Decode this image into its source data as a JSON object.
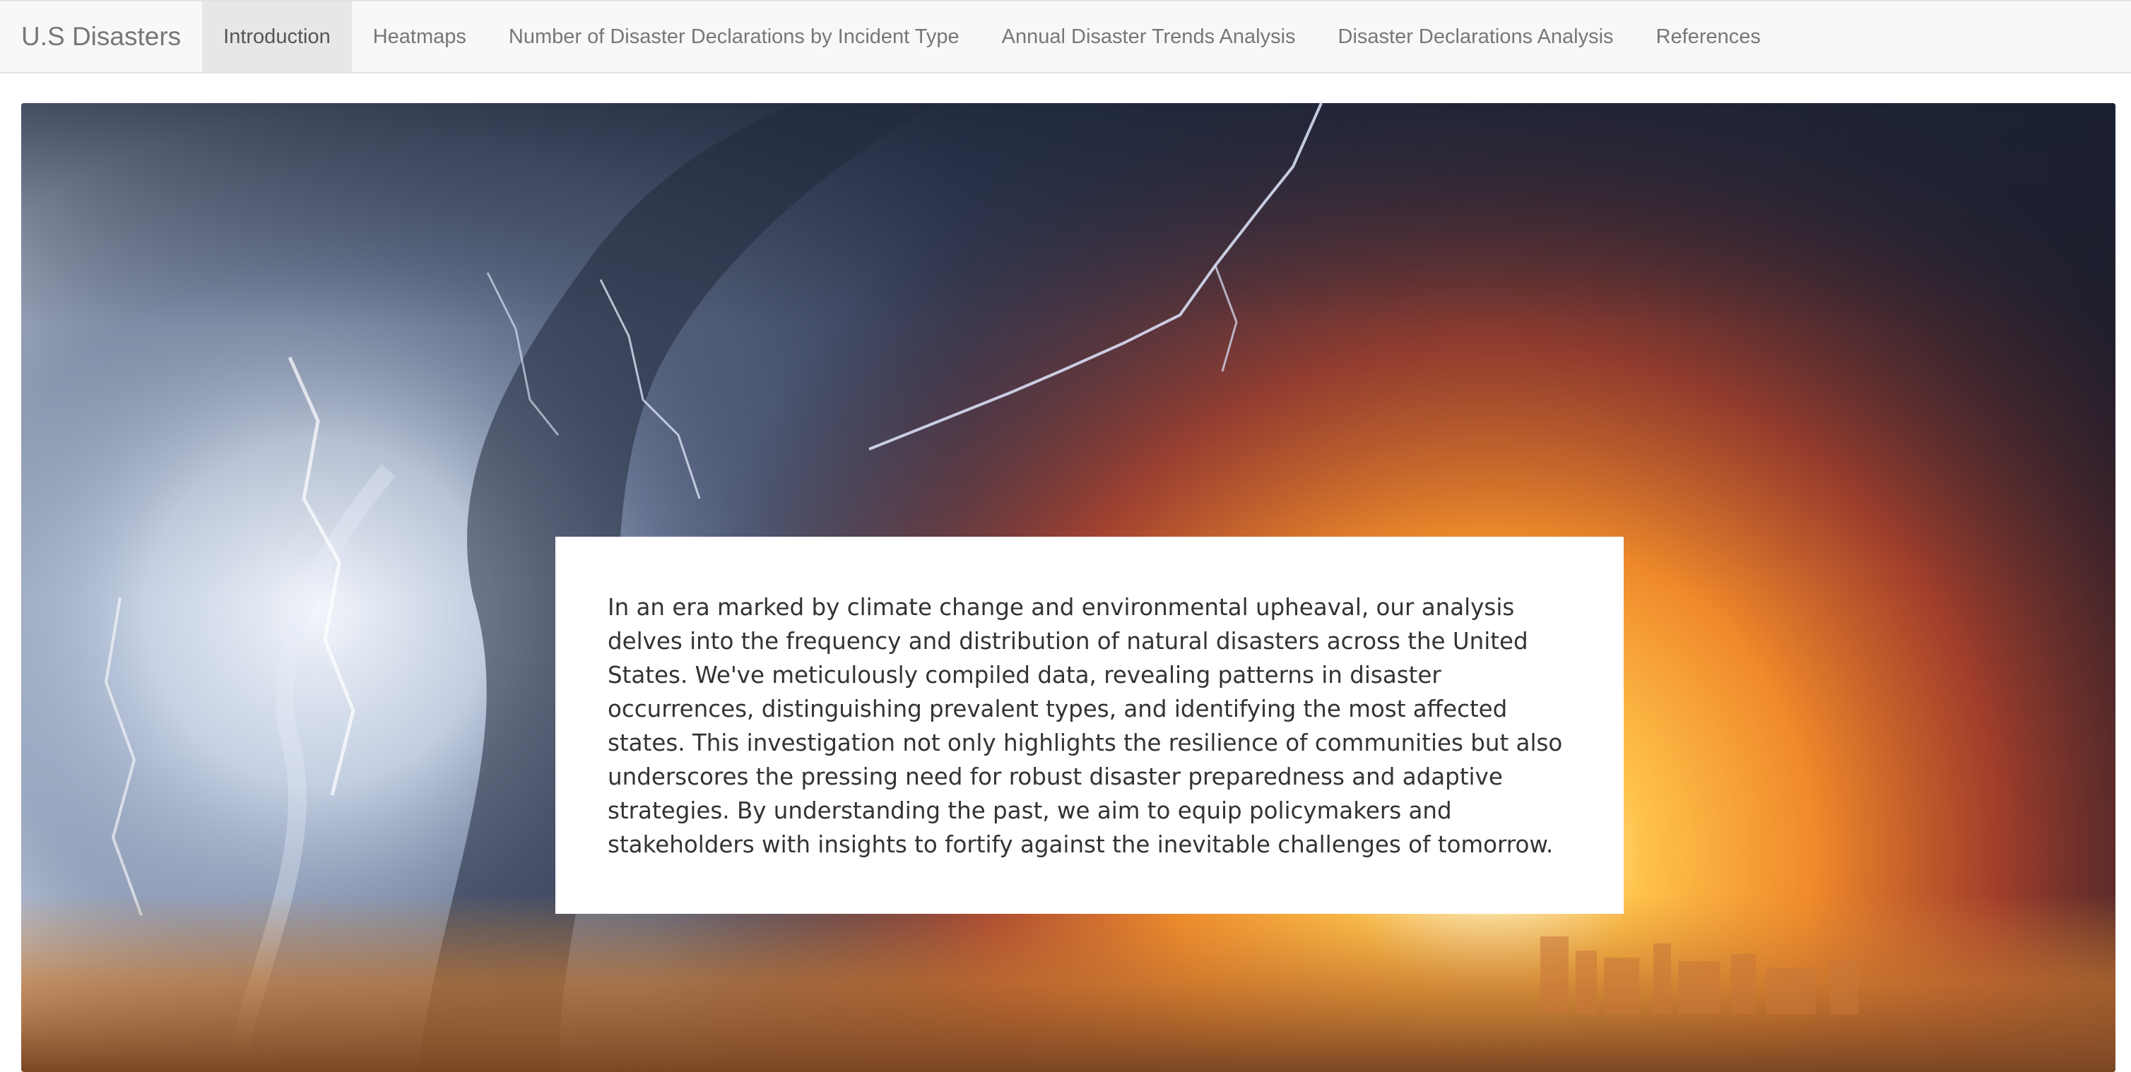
{
  "navbar": {
    "brand": "U.S Disasters",
    "items": [
      {
        "label": "Introduction",
        "active": true
      },
      {
        "label": "Heatmaps",
        "active": false
      },
      {
        "label": "Number of Disaster Declarations by Incident Type",
        "active": false
      },
      {
        "label": "Annual Disaster Trends Analysis",
        "active": false
      },
      {
        "label": "Disaster Declarations Analysis",
        "active": false
      },
      {
        "label": "References",
        "active": false
      }
    ]
  },
  "hero": {
    "image": "storm-tornado-and-sunset-fire-image",
    "intro_text": "In an era marked by climate change and environmental upheaval, our analysis delves into the frequency and distribution of natural disasters across the United States. We've meticulously compiled data, revealing patterns in disaster occurrences, distinguishing prevalent types, and identifying the most affected states. This investigation not only highlights the resilience of communities but also underscores the pressing need for robust disaster preparedness and adaptive strategies. By understanding the past, we aim to equip policymakers and stakeholders with insights to fortify against the inevitable challenges of tomorrow."
  },
  "colors": {
    "navbar_bg": "#f8f8f8",
    "nav_active_bg": "#e7e7e7",
    "nav_text": "#777777",
    "body_text": "#333333"
  }
}
